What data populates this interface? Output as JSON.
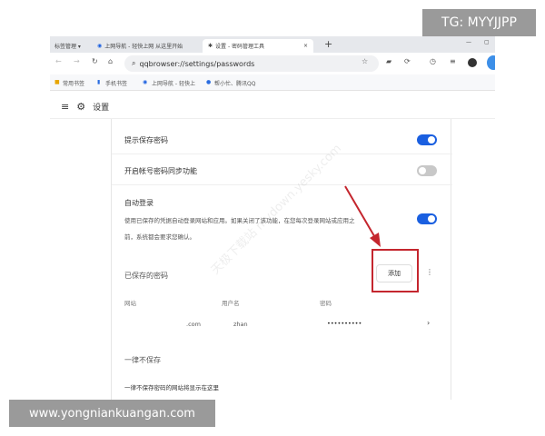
{
  "overlay": {
    "top_right": "TG: MYYJJPP",
    "bottom_left": "www.yongniankuangan.com"
  },
  "browser": {
    "tabs": [
      {
        "label": "标签管理 ▾"
      },
      {
        "label": "上网导航 - 轻快上网 从这里开始"
      },
      {
        "label": "设置 - 密码管理工具",
        "active": true
      }
    ],
    "new_tab": "+",
    "close_tab": "×",
    "url": "qqbrowser://settings/passwords",
    "bookmarks": [
      "常用书签",
      "手机书签",
      "上网导航 - 轻快上",
      "帮小忙、腾讯QQ"
    ]
  },
  "header": {
    "title": "设置"
  },
  "settings": {
    "offer_save": {
      "label": "提示保存密码",
      "enabled": true
    },
    "sync": {
      "label": "开启帐号密码同步功能",
      "enabled": false
    },
    "auto_login": {
      "label": "自动登录",
      "desc1": "使用已保存的凭据自动登录网站和应用。如果关闭了该功能，在您每次登录网站或应用之",
      "desc2": "前，系统都会要求您确认。",
      "enabled": true
    }
  },
  "saved": {
    "title": "已保存的密码",
    "add_button": "添加",
    "more": "⋮",
    "columns": [
      "网站",
      "用户名",
      "密码"
    ],
    "rows": [
      {
        "site": ".com",
        "username": "zhan",
        "password": "••••••••••"
      }
    ]
  },
  "never": {
    "title": "一律不保存",
    "empty": "一律不保存密码的网站将显示在这里"
  },
  "watermark": "天极下载站 mydown.yesky.com",
  "colors": {
    "accent": "#1a5fe0",
    "highlight": "#c4262e"
  }
}
